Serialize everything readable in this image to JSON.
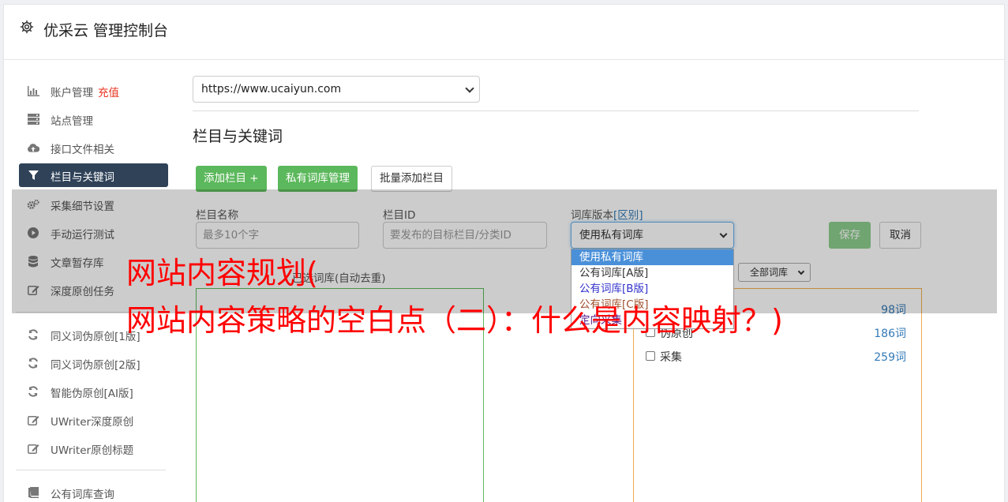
{
  "header": {
    "title": "优采云 管理控制台",
    "icon": "gear-icon"
  },
  "sidebar": {
    "items": [
      {
        "label": "账户管理",
        "badge": "充值",
        "icon": "bar-chart-icon"
      },
      {
        "label": "站点管理",
        "icon": "server-icon"
      },
      {
        "label": "接口文件相关",
        "icon": "cloud-upload-icon"
      },
      {
        "label": "栏目与关键词",
        "icon": "filter-icon",
        "active": true
      },
      {
        "label": "采集细节设置",
        "icon": "cogs-icon"
      },
      {
        "label": "手动运行测试",
        "icon": "play-icon"
      },
      {
        "label": "文章暂存库",
        "icon": "database-icon"
      },
      {
        "label": "深度原创任务",
        "icon": "edit-icon"
      },
      {
        "label": "同义词伪原创[1版]",
        "icon": "refresh-icon"
      },
      {
        "label": "同义词伪原创[2版]",
        "icon": "refresh-icon"
      },
      {
        "label": "智能伪原创[AI版]",
        "icon": "refresh-icon"
      },
      {
        "label": "UWriter深度原创",
        "icon": "edit-icon"
      },
      {
        "label": "UWriter原创标题",
        "icon": "edit-icon"
      },
      {
        "label": "公有词库查询",
        "icon": "book-icon"
      }
    ]
  },
  "main": {
    "site_select": "https://www.ucaiyun.com",
    "section_title": "栏目与关键词",
    "buttons": {
      "add_column": "添加栏目 +",
      "private_lib": "私有词库管理",
      "batch_add": "批量添加栏目",
      "save": "保存",
      "cancel": "取消"
    },
    "form": {
      "column_name_label": "栏目名称",
      "column_name_placeholder": "最多10个字",
      "column_id_label": "栏目ID",
      "column_id_placeholder": "要发布的目标栏目/分类ID",
      "lib_version_label": "词库版本",
      "lib_version_link": "[区别]",
      "lib_version_value": "使用私有词库"
    },
    "dropdown_options": [
      "使用私有词库",
      "公有词库[A版]",
      "公有词库[B版]",
      "公有词库[C版]",
      "定向采集"
    ],
    "keywords_label": "已选词库(自动去重)",
    "all_lib_filter": "全部词库",
    "libraries": [
      {
        "name": "",
        "count": "98词"
      },
      {
        "name": "伪原创",
        "count": "186词"
      },
      {
        "name": "采集",
        "count": "259词"
      }
    ]
  },
  "overlay": {
    "headline_1": "网站内容规划(",
    "headline_2": "网站内容策略的空白点（二）：什么是内容映射？)"
  },
  "colors": {
    "active_nav": "#2f4258",
    "green": "#5cb85c",
    "orange": "#f0ad4e",
    "red_text": "#ff0000",
    "link": "#337ab7"
  }
}
